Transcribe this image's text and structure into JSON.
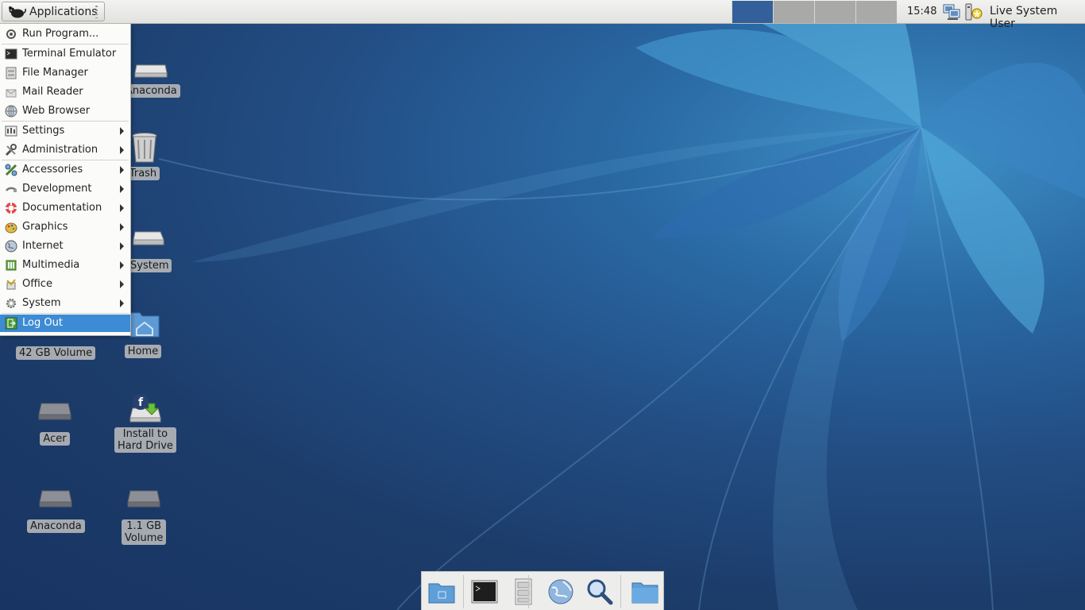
{
  "top_panel": {
    "applications_label": "Applications",
    "clock": "15:48",
    "user": "Live System User",
    "workspaces": [
      "workspace-1",
      "workspace-2",
      "workspace-3",
      "workspace-4"
    ],
    "active_workspace_color": "#33609a",
    "tray_icons": [
      "network-icon",
      "updates-icon"
    ]
  },
  "menu": {
    "items": [
      {
        "label": "Run Program...",
        "icon": "run-icon",
        "submenu": false
      },
      {
        "label": "Terminal Emulator",
        "icon": "terminal-icon",
        "submenu": false
      },
      {
        "label": "File Manager",
        "icon": "file-manager-icon",
        "submenu": false
      },
      {
        "label": "Mail Reader",
        "icon": "mail-icon",
        "submenu": false
      },
      {
        "label": "Web Browser",
        "icon": "globe-icon",
        "submenu": false
      },
      {
        "label": "Settings",
        "icon": "settings-icon",
        "submenu": true
      },
      {
        "label": "Administration",
        "icon": "tools-icon",
        "submenu": true
      },
      {
        "label": "Accessories",
        "icon": "accessories-icon",
        "submenu": true
      },
      {
        "label": "Development",
        "icon": "development-icon",
        "submenu": true
      },
      {
        "label": "Documentation",
        "icon": "help-icon",
        "submenu": true
      },
      {
        "label": "Graphics",
        "icon": "graphics-icon",
        "submenu": true
      },
      {
        "label": "Internet",
        "icon": "internet-icon",
        "submenu": true
      },
      {
        "label": "Multimedia",
        "icon": "multimedia-icon",
        "submenu": true
      },
      {
        "label": "Office",
        "icon": "office-icon",
        "submenu": true
      },
      {
        "label": "System",
        "icon": "system-icon",
        "submenu": true
      },
      {
        "label": "Log Out",
        "icon": "logout-icon",
        "submenu": false,
        "highlighted": true
      }
    ],
    "highlight_color": "#3d8bd4"
  },
  "desktop_icons": [
    {
      "label": "Anaconda",
      "icon": "drive-icon"
    },
    {
      "label": "Trash",
      "icon": "trash-icon"
    },
    {
      "label": "System",
      "icon": "drive-icon"
    },
    {
      "label": "Home",
      "icon": "home-folder-icon"
    },
    {
      "label": "42 GB Volume",
      "icon": "drive-icon"
    },
    {
      "label": "Acer",
      "icon": "drive-icon"
    },
    {
      "label": "Install to\nHard Drive",
      "icon": "install-icon"
    },
    {
      "label": "Anaconda",
      "icon": "drive-icon"
    },
    {
      "label": "1.1 GB\nVolume",
      "icon": "drive-icon"
    }
  ],
  "dock": {
    "items": [
      "show-desktop-icon",
      "terminal-icon",
      "file-manager-icon",
      "web-browser-icon",
      "search-icon",
      "folder-icon"
    ]
  }
}
